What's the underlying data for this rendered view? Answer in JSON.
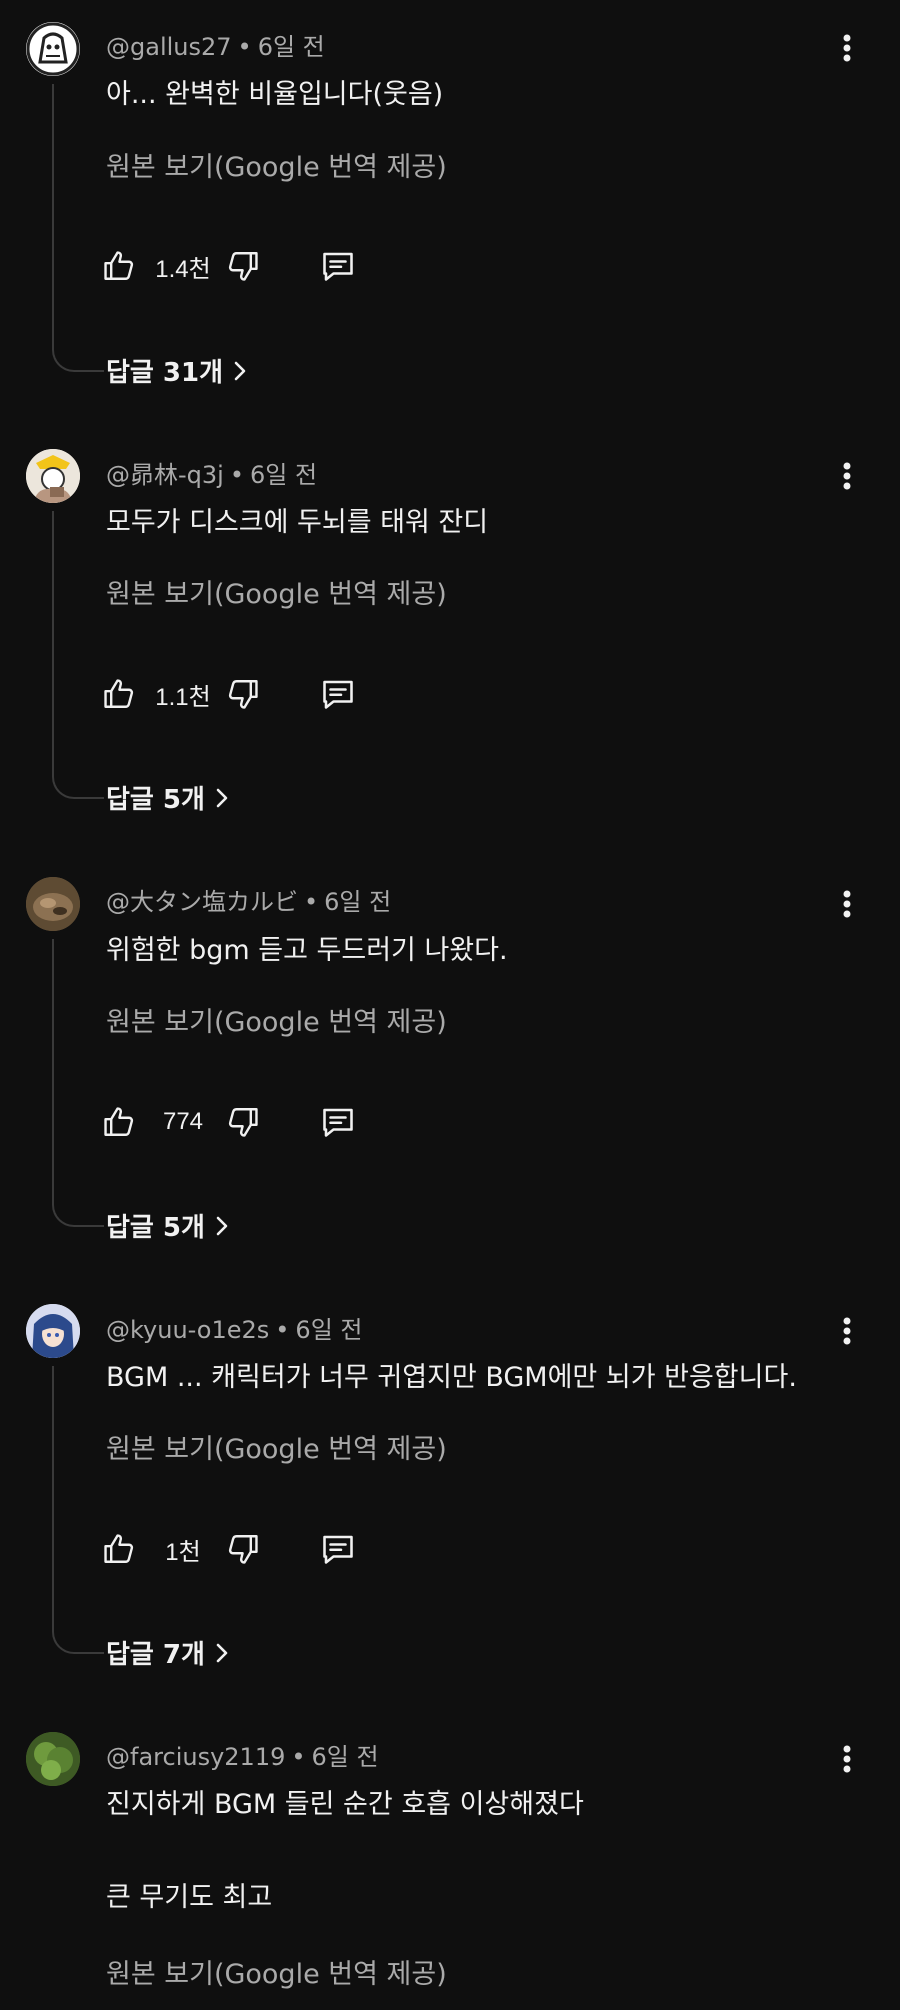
{
  "translate_label": "원본 보기(Google 번역 제공)",
  "comments": [
    {
      "handle": "@gallus27",
      "time": "6일 전",
      "lines": [
        "아... 완벽한 비율입니다(웃음)"
      ],
      "likes": "1.4천",
      "replies": "답글 31개"
    },
    {
      "handle": "@昴林-q3j",
      "time": "6일 전",
      "lines": [
        "모두가 디스크에 두뇌를 태워 잔디"
      ],
      "likes": "1.1천",
      "replies": "답글 5개"
    },
    {
      "handle": "@大タン塩カルビ",
      "time": "6일 전",
      "lines": [
        "위험한 bgm 듣고 두드러기  나왔다."
      ],
      "likes": "774",
      "replies": "답글 5개"
    },
    {
      "handle": "@kyuu-o1e2s",
      "time": "6일 전",
      "lines": [
        "BGM ... 캐릭터가 너무 귀엽지만 BGM에만 뇌가 반응합니다."
      ],
      "likes": "1천",
      "replies": "답글 7개"
    },
    {
      "handle": "@farciusy2119",
      "time": "6일 전",
      "lines": [
        "진지하게 BGM 들린 순간 호흡 이상해졌다",
        "큰 무기도 최고"
      ]
    }
  ],
  "icons": {
    "like": "thumb-up-icon",
    "dislike": "thumb-down-icon",
    "reply": "comment-icon",
    "more": "more-vert-icon",
    "chevron": "chevron-right-icon"
  },
  "colors": {
    "background": "#0f0f0f",
    "text_primary": "#f1f1f1",
    "text_secondary": "#aaaaaa",
    "thread_line": "#3a3a3a"
  }
}
